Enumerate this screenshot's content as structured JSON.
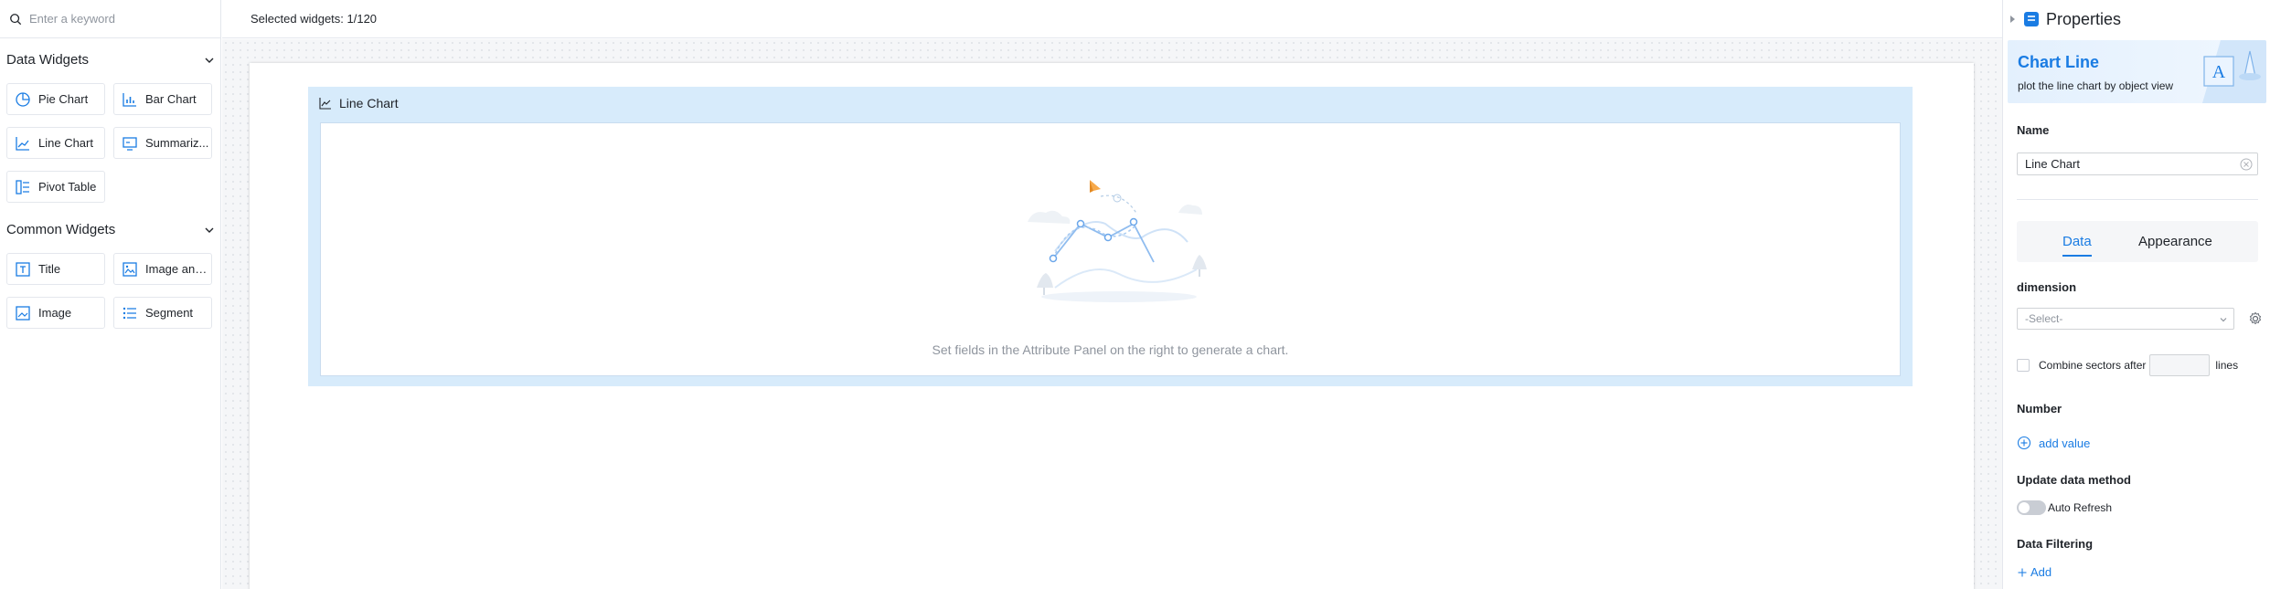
{
  "search": {
    "placeholder": "Enter a keyword"
  },
  "sections": {
    "data_widgets": {
      "title": "Data Widgets",
      "items": [
        {
          "label": "Pie Chart",
          "icon": "pie-chart-icon"
        },
        {
          "label": "Bar Chart",
          "icon": "bar-chart-icon"
        },
        {
          "label": "Line Chart",
          "icon": "line-chart-icon"
        },
        {
          "label": "Summariz...",
          "icon": "summary-icon"
        },
        {
          "label": "Pivot Table",
          "icon": "pivot-table-icon"
        }
      ]
    },
    "common_widgets": {
      "title": "Common Widgets",
      "items": [
        {
          "label": "Title",
          "icon": "title-icon"
        },
        {
          "label": "Image and...",
          "icon": "image-text-icon"
        },
        {
          "label": "Image",
          "icon": "image-icon"
        },
        {
          "label": "Segment",
          "icon": "segment-icon"
        }
      ]
    }
  },
  "topbar": {
    "selected": "Selected widgets: 1/120"
  },
  "canvas": {
    "widget_title": "Line Chart",
    "empty_text": "Set fields in the Attribute Panel on the right to generate a chart."
  },
  "properties": {
    "header": "Properties",
    "banner_title": "Chart Line",
    "banner_subtitle": "plot the line chart by object view",
    "name_label": "Name",
    "name_value": "Line Chart",
    "tabs": [
      "Data",
      "Appearance"
    ],
    "active_tab": "Data",
    "dimension_label": "dimension",
    "dimension_placeholder": "-Select-",
    "combine_prefix": "Combine sectors after",
    "combine_suffix": "lines",
    "number_label": "Number",
    "add_value": "add value",
    "update_label": "Update data method",
    "auto_refresh": "Auto Refresh",
    "auto_refresh_on": false,
    "filter_label": "Data Filtering",
    "add_filter": "Add"
  },
  "colors": {
    "accent": "#1a7ce3",
    "widget_bg": "#d7ebfb"
  }
}
